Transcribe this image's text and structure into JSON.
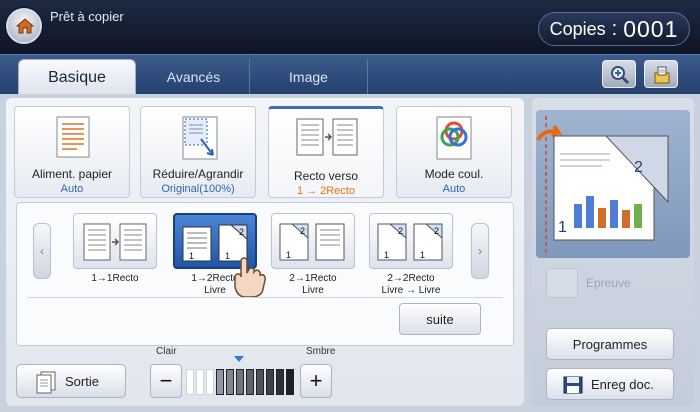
{
  "status": {
    "title": "Prêt à copier"
  },
  "copies": {
    "label": "Copies",
    "separator": ":",
    "value": "0001"
  },
  "tabs": [
    {
      "label": "Basique",
      "active": true
    },
    {
      "label": "Avancés",
      "active": false
    },
    {
      "label": "Image",
      "active": false
    }
  ],
  "toolbar_icons": [
    "zoom-in-icon",
    "job-status-icon"
  ],
  "functions": [
    {
      "name": "Aliment. papier",
      "value": "Auto",
      "icon": "paper-tray-icon"
    },
    {
      "name": "Réduire/Agrandir",
      "value": "Original(100%)",
      "icon": "reduce-enlarge-icon"
    },
    {
      "name": "Recto verso",
      "value": "1 → 2Recto",
      "icon": "duplex-icon",
      "active": true
    },
    {
      "name": "Mode coul.",
      "value": "Auto",
      "icon": "color-mode-icon"
    }
  ],
  "duplex_options": [
    {
      "label1": "1→1Recto",
      "label2": "",
      "selected": false
    },
    {
      "label1": "1→2Recto",
      "label2": "Livre",
      "selected": true
    },
    {
      "label1": "2→1Recto",
      "label2": "Livre",
      "selected": false
    },
    {
      "label1": "2→2Recto",
      "label2": "Livre → Livre",
      "selected": false
    }
  ],
  "suite_label": "suite",
  "sortie_label": "Sortie",
  "darkness": {
    "light_label": "Clair",
    "dark_label": "Smbre",
    "level": 5,
    "steps": 11
  },
  "epreuve_label": "Epreuve",
  "programmes_label": "Programmes",
  "save_label": "Enreg doc.",
  "colors": {
    "accent": "#2f64b3",
    "orange": "#e8730c",
    "header": "#0e1526",
    "tab": "#3d5b8c"
  }
}
